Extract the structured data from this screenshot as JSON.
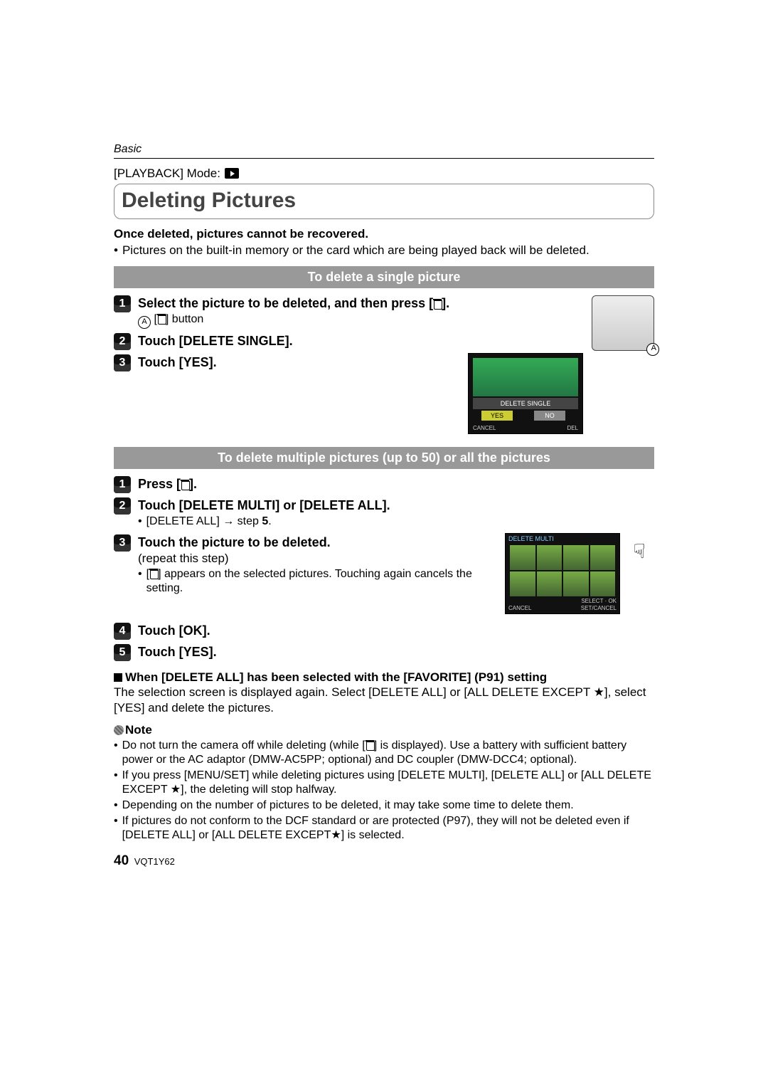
{
  "header": {
    "section": "Basic",
    "playback_label": "[PLAYBACK] Mode:"
  },
  "title": "Deleting Pictures",
  "intro": {
    "warn": "Once deleted, pictures cannot be recovered.",
    "bullet": "Pictures on the built-in memory or the card which are being played back will be deleted."
  },
  "section1": {
    "bar": "To delete a single picture",
    "step1_title_a": "Select the picture to be deleted, and then press [",
    "step1_title_b": "].",
    "step1_sub_a": "[",
    "step1_sub_b": "] button",
    "step2_title": "Touch [DELETE SINGLE].",
    "step3_title": "Touch [YES].",
    "screen_bar": "DELETE SINGLE",
    "screen_yes": "YES",
    "screen_no": "NO",
    "screen_cancel": "CANCEL",
    "screen_del": "DEL"
  },
  "section2": {
    "bar": "To delete multiple pictures (up to 50) or all the pictures",
    "step1_title_a": "Press [",
    "step1_title_b": "].",
    "step2_title": "Touch [DELETE MULTI] or [DELETE ALL].",
    "step2_bullet_a": "[DELETE ALL] ",
    "step2_bullet_arrow": "→",
    "step2_bullet_b": " step ",
    "step2_bullet_num": "5",
    "step2_bullet_dot": ".",
    "step3_title": "Touch the picture to be deleted.",
    "step3_sub": "(repeat this step)",
    "step3_bullet_a": "[",
    "step3_bullet_b": "] appears on the selected pictures. Touching again cancels the setting.",
    "step4_title": "Touch [OK].",
    "step5_title": "Touch [YES].",
    "multi_hdr": "DELETE MULTI",
    "multi_cancel": "CANCEL",
    "multi_set": "SET/CANCEL",
    "multi_select": "SELECT",
    "multi_ok": "OK"
  },
  "favorite": {
    "heading": "When [DELETE ALL] has been selected with the [FAVORITE] (P91) setting",
    "body_a": "The selection screen is displayed again. Select [DELETE ALL] or [ALL DELETE EXCEPT ",
    "body_b": "], select [YES] and delete the pictures."
  },
  "note_label": "Note",
  "notes": {
    "n1_a": "Do not turn the camera off while deleting (while [",
    "n1_b": "] is displayed). Use a battery with sufficient battery power or the AC adaptor (DMW-AC5PP; optional) and DC coupler (DMW-DCC4; optional).",
    "n2_a": "If you press [MENU/SET] while deleting pictures using [DELETE MULTI], [DELETE ALL] or [ALL DELETE EXCEPT ",
    "n2_b": "], the deleting will stop halfway.",
    "n3": "Depending on the number of pictures to be deleted, it may take some time to delete them.",
    "n4_a": "If pictures do not conform to the DCF standard or are protected (P97), they will not be deleted even if [DELETE ALL] or [ALL DELETE EXCEPT",
    "n4_b": "] is selected."
  },
  "footer": {
    "page": "40",
    "code": "VQT1Y62"
  },
  "circle_letter": "A",
  "star": "★"
}
